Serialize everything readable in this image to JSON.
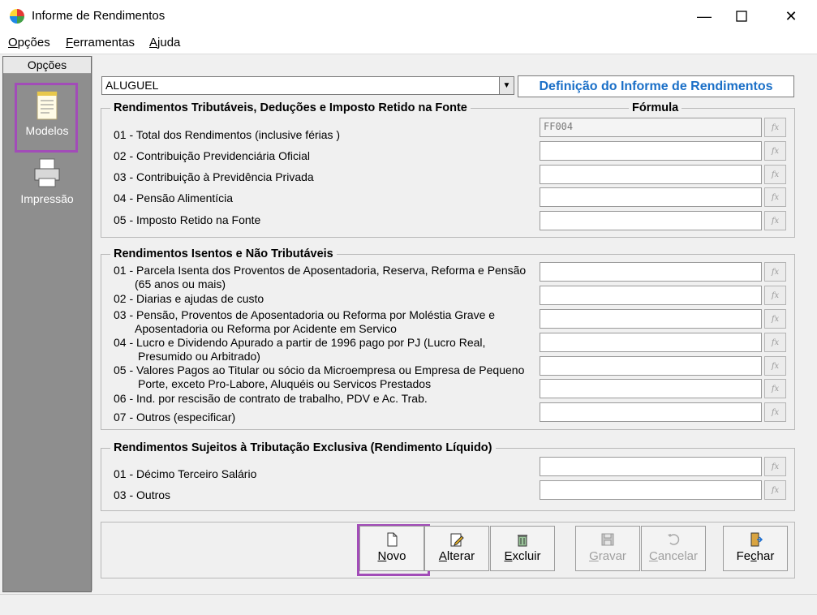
{
  "window": {
    "title": "Informe de Rendimentos",
    "min": "—",
    "max": "☐",
    "close": "✕"
  },
  "menu": [
    {
      "accel": "O",
      "rest": "pções"
    },
    {
      "accel": "F",
      "rest": "erramentas"
    },
    {
      "accel": "A",
      "rest": "juda"
    }
  ],
  "sidebar": {
    "header": "Opções",
    "items": [
      {
        "label": "Modelos",
        "icon": "document-icon",
        "selected": true
      },
      {
        "label": "Impressão",
        "icon": "printer-icon"
      }
    ]
  },
  "selector": {
    "value": "ALUGUEL",
    "dropdown_arrow": "▼"
  },
  "definition_title": "Definição do Informe de Rendimentos",
  "section1": {
    "title": "Rendimentos Tributáveis, Deduções e Imposto Retido na Fonte",
    "formula_header": "Fórmula",
    "rows": [
      {
        "label": "01 - Total dos Rendimentos (inclusive férias )",
        "formula": "FF004"
      },
      {
        "label": "02 - Contribuição Previdenciária Oficial",
        "formula": ""
      },
      {
        "label": "03 - Contribuição à Previdência Privada",
        "formula": ""
      },
      {
        "label": "04 - Pensão Alimentícia",
        "formula": ""
      },
      {
        "label": "05 - Imposto Retido na Fonte",
        "formula": ""
      }
    ]
  },
  "section2": {
    "title": "Rendimentos Isentos e Não Tributáveis",
    "rows": [
      {
        "line1": "01 - Parcela Isenta dos Proventos de Aposentadoria, Reserva, Reforma e Pensão",
        "line2": "(65 anos ou mais)"
      },
      {
        "line1": "02 - Diarias e ajudas de custo",
        "line2": ""
      },
      {
        "line1": "03 - Pensão, Proventos de Aposentadoria ou Reforma por Moléstia Grave e",
        "line2": "Aposentadoria ou Reforma por Acidente em Servico"
      },
      {
        "line1": "04 - Lucro e Dividendo Apurado a partir de 1996 pago por PJ (Lucro Real,",
        "line2": "Presumido ou Arbitrado)"
      },
      {
        "line1": "05 - Valores Pagos ao Titular ou sócio da Microempresa ou Empresa de Pequeno",
        "line2": "Porte, exceto Pro-Labore, Aluquéis ou Servicos Prestados"
      },
      {
        "line1": "06 - Ind. por rescisão de contrato de trabalho, PDV e Ac. Trab.",
        "line2": ""
      },
      {
        "line1": "07 - Outros (especificar)",
        "line2": ""
      }
    ]
  },
  "section3": {
    "title": "Rendimentos Sujeitos à Tributação Exclusiva (Rendimento Líquido)",
    "rows": [
      {
        "label": "01 - Décimo Terceiro Salário"
      },
      {
        "label": "03 - Outros"
      }
    ]
  },
  "fx_label": "fx",
  "buttons": [
    {
      "accel": "N",
      "rest": "ovo",
      "icon": "new-document-icon",
      "enabled": true
    },
    {
      "accel": "A",
      "rest": "lterar",
      "icon": "edit-icon",
      "enabled": true
    },
    {
      "accel": "E",
      "rest": "xcluir",
      "icon": "trash-icon",
      "enabled": true
    },
    {
      "accel": "G",
      "rest": "ravar",
      "icon": "save-icon",
      "enabled": false
    },
    {
      "accel": "C",
      "rest": "ancelar",
      "icon": "undo-icon",
      "enabled": false
    },
    {
      "accel": "c",
      "pre": "Fe",
      "rest": "har",
      "icon": "exit-door-icon",
      "enabled": true
    }
  ]
}
